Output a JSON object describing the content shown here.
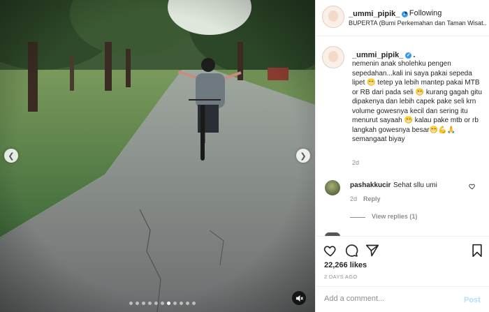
{
  "post": {
    "username": "_ummi_pipik_",
    "follow_separator": "•",
    "follow_label": "Following",
    "location": "BUPERTA (Bumi Perkemahan dan Taman Wisat..."
  },
  "caption": {
    "username": "_ummi_pipik_",
    "trailing_dot": ".",
    "text": "nemenin anak sholehku pengen sepedahan...kali ini saya pakai sepeda lipet 😁 tetep ya lebih mantep pakai MTB or RB dari pada seli 😁 kurang gagah gitu dipakenya dan lebih capek pake seli krn volume gowesnya kecil dan sering itu menurut sayaah 😁 kalau pake mtb or rb langkah gowesnya besar😁💪🙏 semangaat biyay",
    "time": "2d"
  },
  "comments": [
    {
      "username": "pashakkucir",
      "text": "Sehat sllu umi",
      "time": "2d",
      "reply_label": "Reply",
      "view_replies": "View replies (1)"
    }
  ],
  "stats": {
    "likes": "22,266 likes",
    "date": "2 DAYS AGO"
  },
  "composer": {
    "placeholder": "Add a comment...",
    "post_label": "Post"
  },
  "carousel": {
    "dot_count": 11,
    "active_index": 6
  },
  "icons": {
    "verified": "verified-badge-icon",
    "like": "heart-icon",
    "comment": "comment-bubble-icon",
    "share": "paper-plane-icon",
    "save": "bookmark-icon",
    "mute": "speaker-muted-icon",
    "prev": "chevron-left-icon",
    "next": "chevron-right-icon"
  },
  "colors": {
    "verified_blue": "#3897f0",
    "post_button_disabled": "#b2dffc",
    "secondary_text": "#8e8e8e"
  }
}
